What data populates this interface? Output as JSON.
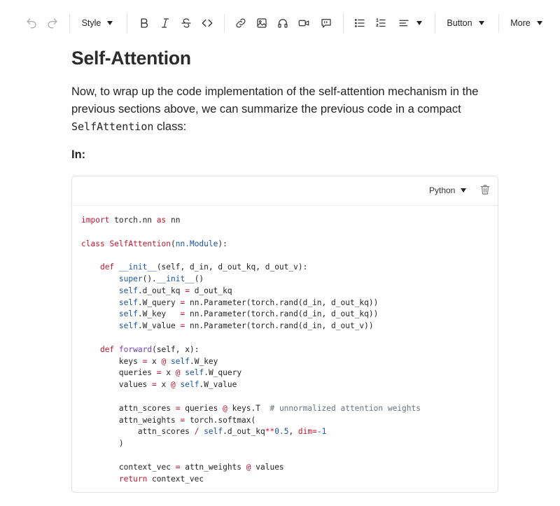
{
  "toolbar": {
    "style_label": "Style",
    "button_label": "Button",
    "more_label": "More",
    "icons": [
      "undo-icon",
      "redo-icon",
      "bold-icon",
      "italic-icon",
      "strikethrough-icon",
      "code-icon",
      "link-icon",
      "image-icon",
      "audio-icon",
      "video-icon",
      "quote-icon",
      "bullet-list-icon",
      "numbered-list-icon",
      "align-icon"
    ]
  },
  "article": {
    "title": "Self-Attention",
    "para_part1": "Now, to wrap up the code implementation of the self-attention mechanism in the previous sections above, we can summarize the previous code in a compact ",
    "para_code": "SelfAttention",
    "para_part2": " class:",
    "in_label": "In:"
  },
  "code_block": {
    "language": "Python",
    "lines": [
      [
        {
          "t": "import",
          "c": "k"
        },
        {
          "t": " torch.nn "
        },
        {
          "t": "as",
          "c": "k"
        },
        {
          "t": " nn"
        }
      ],
      [],
      [
        {
          "t": "class",
          "c": "k"
        },
        {
          "t": " "
        },
        {
          "t": "SelfAttention",
          "c": "cl"
        },
        {
          "t": "("
        },
        {
          "t": "nn.Module",
          "c": "b"
        },
        {
          "t": "):"
        }
      ],
      [],
      [
        {
          "t": "    "
        },
        {
          "t": "def",
          "c": "k"
        },
        {
          "t": " "
        },
        {
          "t": "__init__",
          "c": "b"
        },
        {
          "t": "(self, d_in, d_out_kq, d_out_v):"
        }
      ],
      [
        {
          "t": "        "
        },
        {
          "t": "super",
          "c": "b"
        },
        {
          "t": "()."
        },
        {
          "t": "__init__",
          "c": "b"
        },
        {
          "t": "()"
        }
      ],
      [
        {
          "t": "        "
        },
        {
          "t": "self",
          "c": "b"
        },
        {
          "t": ".d_out_kq "
        },
        {
          "t": "=",
          "c": "k"
        },
        {
          "t": " d_out_kq"
        }
      ],
      [
        {
          "t": "        "
        },
        {
          "t": "self",
          "c": "b"
        },
        {
          "t": ".W_query "
        },
        {
          "t": "=",
          "c": "k"
        },
        {
          "t": " nn.Parameter(torch.rand(d_in, d_out_kq))"
        }
      ],
      [
        {
          "t": "        "
        },
        {
          "t": "self",
          "c": "b"
        },
        {
          "t": ".W_key   "
        },
        {
          "t": "=",
          "c": "k"
        },
        {
          "t": " nn.Parameter(torch.rand(d_in, d_out_kq))"
        }
      ],
      [
        {
          "t": "        "
        },
        {
          "t": "self",
          "c": "b"
        },
        {
          "t": ".W_value "
        },
        {
          "t": "=",
          "c": "k"
        },
        {
          "t": " nn.Parameter(torch.rand(d_in, d_out_v))"
        }
      ],
      [],
      [
        {
          "t": "    "
        },
        {
          "t": "def",
          "c": "k"
        },
        {
          "t": " "
        },
        {
          "t": "forward",
          "c": "f"
        },
        {
          "t": "(self, x):"
        }
      ],
      [
        {
          "t": "        keys "
        },
        {
          "t": "=",
          "c": "k"
        },
        {
          "t": " x "
        },
        {
          "t": "@",
          "c": "k"
        },
        {
          "t": " "
        },
        {
          "t": "self",
          "c": "b"
        },
        {
          "t": ".W_key"
        }
      ],
      [
        {
          "t": "        queries "
        },
        {
          "t": "=",
          "c": "k"
        },
        {
          "t": " x "
        },
        {
          "t": "@",
          "c": "k"
        },
        {
          "t": " "
        },
        {
          "t": "self",
          "c": "b"
        },
        {
          "t": ".W_query"
        }
      ],
      [
        {
          "t": "        values "
        },
        {
          "t": "=",
          "c": "k"
        },
        {
          "t": " x "
        },
        {
          "t": "@",
          "c": "k"
        },
        {
          "t": " "
        },
        {
          "t": "self",
          "c": "b"
        },
        {
          "t": ".W_value"
        }
      ],
      [],
      [
        {
          "t": "        attn_scores "
        },
        {
          "t": "=",
          "c": "k"
        },
        {
          "t": " queries "
        },
        {
          "t": "@",
          "c": "k"
        },
        {
          "t": " keys.T  "
        },
        {
          "t": "# unnormalized attention weights",
          "c": "c"
        }
      ],
      [
        {
          "t": "        attn_weights "
        },
        {
          "t": "=",
          "c": "k"
        },
        {
          "t": " torch.softmax("
        }
      ],
      [
        {
          "t": "            attn_scores "
        },
        {
          "t": "/",
          "c": "k"
        },
        {
          "t": " "
        },
        {
          "t": "self",
          "c": "b"
        },
        {
          "t": ".d_out_kq"
        },
        {
          "t": "**",
          "c": "k"
        },
        {
          "t": "0.5",
          "c": "n"
        },
        {
          "t": ", "
        },
        {
          "t": "dim",
          "c": "d"
        },
        {
          "t": "=",
          "c": "k"
        },
        {
          "t": "-1",
          "c": "n"
        }
      ],
      [
        {
          "t": "        )"
        }
      ],
      [],
      [
        {
          "t": "        context_vec "
        },
        {
          "t": "=",
          "c": "k"
        },
        {
          "t": " attn_weights "
        },
        {
          "t": "@",
          "c": "k"
        },
        {
          "t": " values"
        }
      ],
      [
        {
          "t": "        "
        },
        {
          "t": "return",
          "c": "k"
        },
        {
          "t": " context_vec"
        }
      ]
    ]
  }
}
